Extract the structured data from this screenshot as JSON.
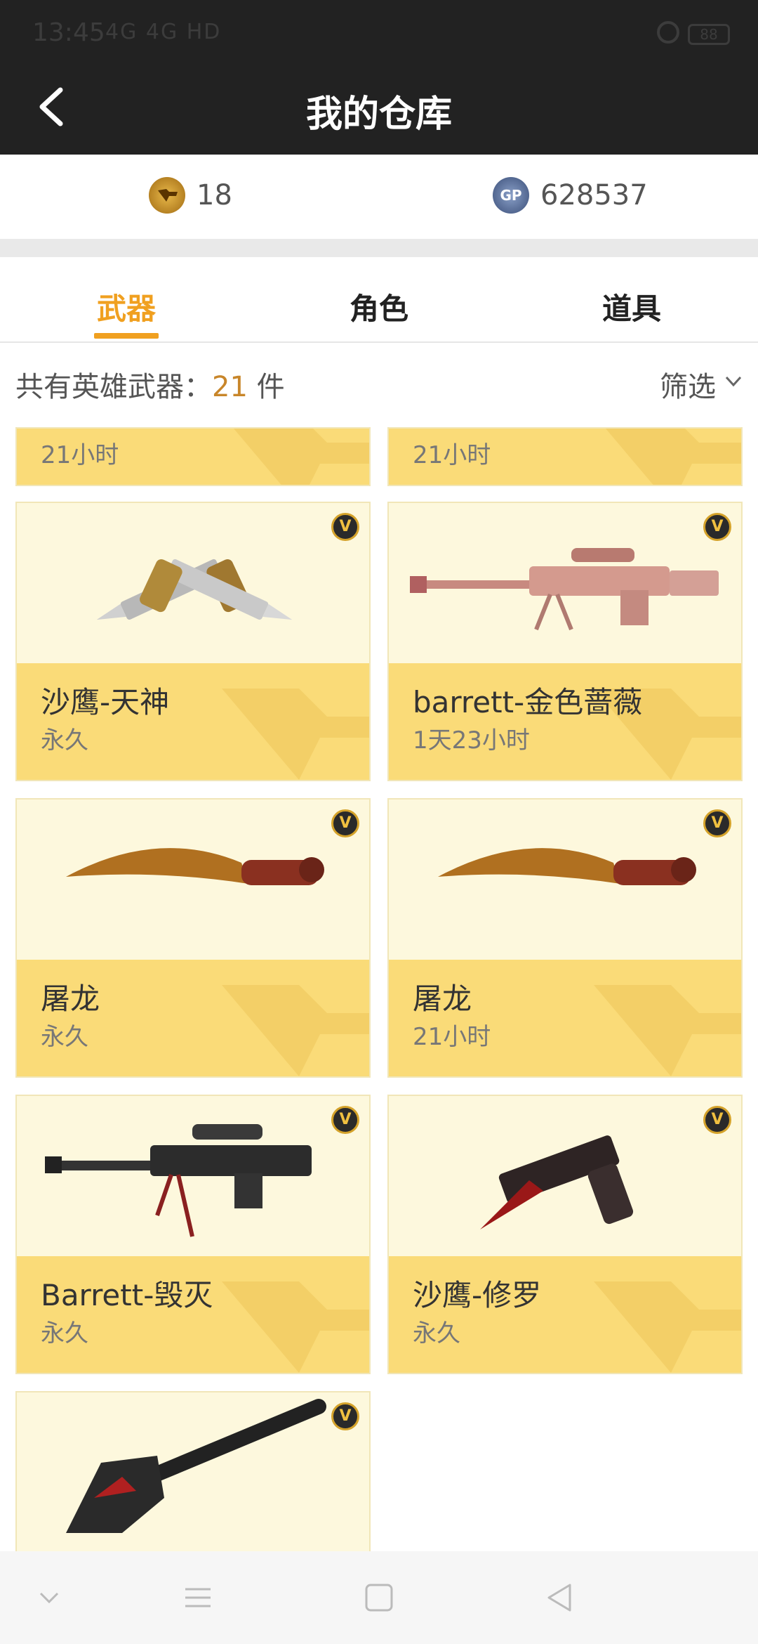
{
  "status_bar": {
    "time": "13:45",
    "network": "4G 4G HD",
    "battery": "88"
  },
  "header": {
    "title": "我的仓库"
  },
  "currency": {
    "cf_icon": "cf-coin-icon",
    "cf_value": "18",
    "gp_icon": "gp-coin-icon",
    "gp_label": "GP",
    "gp_value": "628537"
  },
  "tabs": [
    {
      "label": "武器",
      "active": true
    },
    {
      "label": "角色",
      "active": false
    },
    {
      "label": "道具",
      "active": false
    }
  ],
  "summary": {
    "prefix": "共有英雄武器：",
    "count": "21",
    "suffix": " 件",
    "filter_label": "筛选"
  },
  "items": [
    {
      "name": "",
      "duration": "21小时",
      "partial": true
    },
    {
      "name": "",
      "duration": "21小时",
      "partial": true
    },
    {
      "name": "沙鹰-天神",
      "duration": "永久",
      "badge": "V",
      "weapon": "dual-pistol-gold"
    },
    {
      "name": "barrett-金色蔷薇",
      "duration": "1天23小时",
      "badge": "V",
      "weapon": "sniper-rose"
    },
    {
      "name": "屠龙",
      "duration": "永久",
      "badge": "V",
      "weapon": "dragon-knife"
    },
    {
      "name": "屠龙",
      "duration": "21小时",
      "badge": "V",
      "weapon": "dragon-knife"
    },
    {
      "name": "Barrett-毁灭",
      "duration": "永久",
      "badge": "V",
      "weapon": "sniper-dark"
    },
    {
      "name": "沙鹰-修罗",
      "duration": "永久",
      "badge": "V",
      "weapon": "pistol-dark"
    },
    {
      "name": "",
      "duration": "",
      "badge": "V",
      "weapon": "shovel-dark"
    }
  ],
  "colors": {
    "accent": "#f0a020",
    "card_bottom": "#fadb78",
    "card_top": "#fdf8dd",
    "header_bg": "#222222"
  }
}
